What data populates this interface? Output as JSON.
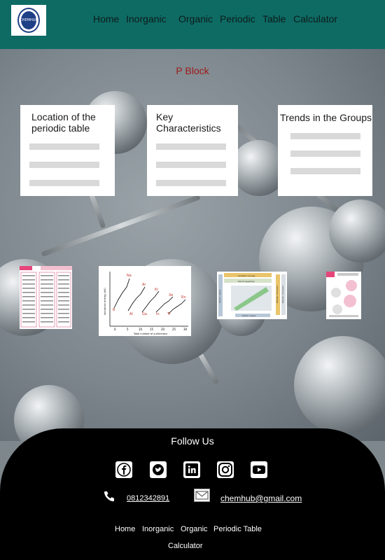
{
  "header": {
    "logo_text": "CHEMHUB",
    "nav": [
      "Home",
      "Inorganic",
      "Organic",
      "Periodic",
      "Table",
      "Calculator"
    ]
  },
  "page": {
    "title": "P Block"
  },
  "cards": [
    {
      "title": "Location of the periodic table"
    },
    {
      "title": "Key Characteristics"
    },
    {
      "title": "Trends in the Groups"
    }
  ],
  "thumbnails": {
    "chart": {
      "elements": [
        "Na",
        "Ar",
        "Kr",
        "Xe",
        "Rn",
        "B",
        "Al",
        "Ga",
        "In",
        "Tl"
      ],
      "ticks": [
        "0",
        "5",
        "10",
        "15",
        "20",
        "25",
        "30"
      ],
      "xlabel": "Total number of p-electrons",
      "ylabel": "Ionization energy (eV)"
    },
    "trends": {
      "labels": [
        "Ionization energy",
        "Electronegativity",
        "Atomic radius",
        "Metallic character",
        "Metallic character",
        "Atomic radius"
      ]
    }
  },
  "footer": {
    "follow": "Follow Us",
    "social": [
      "facebook",
      "twitter",
      "linkedin",
      "instagram",
      "youtube"
    ],
    "phone": "0812342891",
    "email": "chemhub@gmail.com",
    "links": [
      "Home",
      "Inorganic",
      "Organic",
      "Periodic Table",
      "Calculator"
    ]
  },
  "colors": {
    "header": "#0e6b64",
    "title": "#9e1a1a",
    "footer": "#000000"
  }
}
